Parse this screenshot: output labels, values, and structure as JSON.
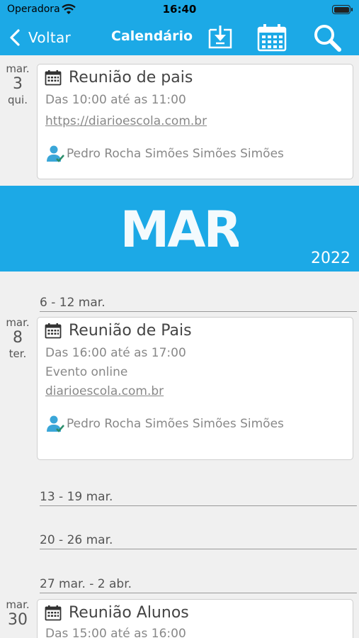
{
  "status": {
    "carrier": "Operadora",
    "time": "16:40"
  },
  "nav": {
    "back_label": "Voltar",
    "title": "Calendário"
  },
  "banner": {
    "month": "MAR",
    "year": "2022"
  },
  "day1": {
    "month": "mar.",
    "day": "3",
    "weekday": "qui."
  },
  "event1": {
    "title": "Reunião de pais",
    "time": "Das 10:00 até as 11:00",
    "link": "https://diarioescola.com.br",
    "person": "Pedro Rocha Simões Simões Simões"
  },
  "weeks": [
    "6 - 12 mar.",
    "13 - 19 mar.",
    "20 - 26 mar.",
    "27 mar. - 2 abr."
  ],
  "day2": {
    "month": "mar.",
    "day": "8",
    "weekday": "ter."
  },
  "event2": {
    "title": "Reunião de Pais",
    "time": "Das 16:00 até as 17:00",
    "place": "Evento online",
    "link": "diarioescola.com.br",
    "person": "Pedro Rocha Simões Simões Simões"
  },
  "day3": {
    "month": "mar.",
    "day": "30"
  },
  "event3": {
    "title": "Reunião Alunos",
    "time": "Das 15:00 até as 16:00"
  },
  "colors": {
    "accent": "#1ca9e6",
    "background": "#f0f0f0"
  }
}
